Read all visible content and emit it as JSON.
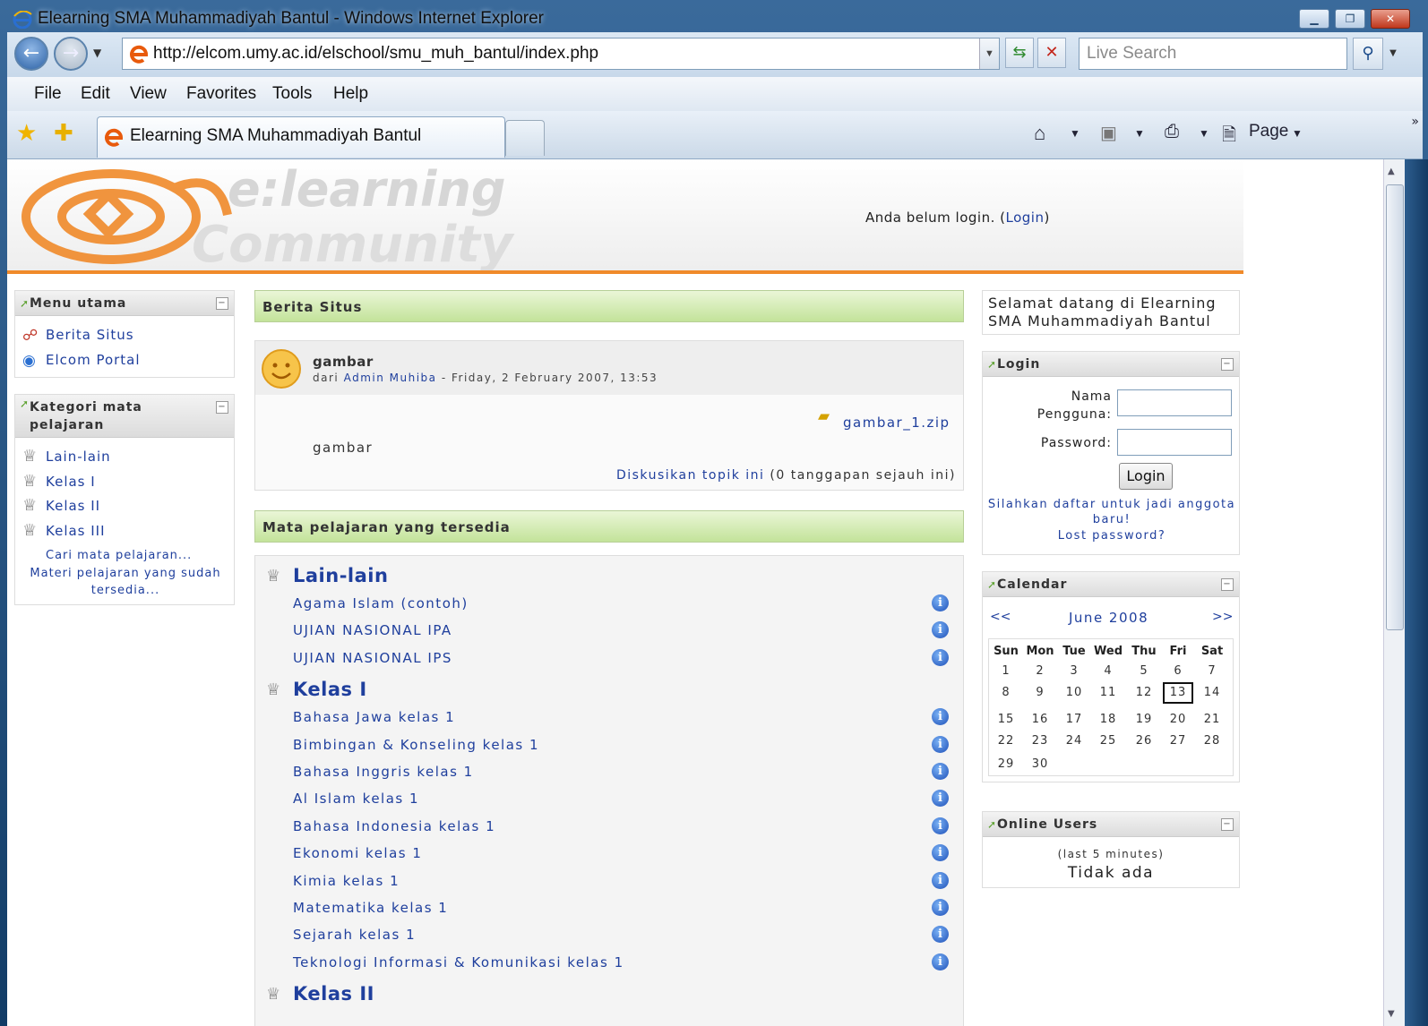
{
  "window": {
    "title": "Elearning SMA Muhammadiyah Bantul - Windows Internet Explorer",
    "url": "http://elcom.umy.ac.id/elschool/smu_muh_bantul/index.php",
    "search_placeholder": "Live Search"
  },
  "menu": [
    "File",
    "Edit",
    "View",
    "Favorites",
    "Tools",
    "Help"
  ],
  "tab": {
    "title": "Elearning SMA Muhammadiyah Bantul"
  },
  "commandbar": {
    "page_label": "Page"
  },
  "header": {
    "login_status": "Anda belum login. (",
    "login_link": "Login",
    "login_close": ")",
    "logo_line1": "e:learning",
    "logo_line2": "Community"
  },
  "menu_utama": {
    "title": "Menu utama",
    "items": [
      "Berita Situs",
      "Elcom Portal"
    ]
  },
  "kategori": {
    "title": "Kategori mata pelajaran",
    "items": [
      "Lain-lain",
      "Kelas I",
      "Kelas II",
      "Kelas III"
    ],
    "search_link": "Cari mata pelajaran...",
    "all_link": "Materi pelajaran yang sudah tersedia..."
  },
  "news": {
    "section_title": "Berita Situs",
    "post_title": "gambar",
    "author_prefix": "dari",
    "author": "Admin Muhiba",
    "date": "- Friday, 2 February 2007, 13:53",
    "attachment": "gambar_1.zip",
    "body": "gambar",
    "discuss": "Diskusikan topik ini",
    "replies": "(0 tanggapan sejauh ini)"
  },
  "courses": {
    "section_title": "Mata pelajaran yang tersedia",
    "categories": [
      {
        "name": "Lain-lain",
        "items": [
          "Agama Islam (contoh)",
          "UJIAN NASIONAL IPA",
          "UJIAN NASIONAL IPS"
        ]
      },
      {
        "name": "Kelas I",
        "items": [
          "Bahasa Jawa kelas 1",
          "Bimbingan & Konseling kelas 1",
          "Bahasa Inggris kelas 1",
          "Al Islam kelas 1",
          "Bahasa Indonesia kelas 1",
          "Ekonomi kelas 1",
          "Kimia kelas 1",
          "Matematika kelas 1",
          "Sejarah kelas 1",
          "Teknologi Informasi & Komunikasi kelas 1"
        ]
      },
      {
        "name": "Kelas II",
        "items": []
      }
    ]
  },
  "welcome": {
    "text": "Selamat datang di Elearning SMA Muhammadiyah Bantul"
  },
  "login": {
    "title": "Login",
    "username_label_1": "Nama",
    "username_label_2": "Pengguna:",
    "password_label": "Password:",
    "button": "Login",
    "signup_link": "Silahkan daftar untuk jadi anggota baru!",
    "lost_password": "Lost password?"
  },
  "calendar": {
    "title": "Calendar",
    "prev": "<<",
    "next": ">>",
    "month": "June 2008",
    "weekdays": [
      "Sun",
      "Mon",
      "Tue",
      "Wed",
      "Thu",
      "Fri",
      "Sat"
    ],
    "weeks": [
      [
        "1",
        "2",
        "3",
        "4",
        "5",
        "6",
        "7"
      ],
      [
        "8",
        "9",
        "10",
        "11",
        "12",
        "13",
        "14"
      ],
      [
        "15",
        "16",
        "17",
        "18",
        "19",
        "20",
        "21"
      ],
      [
        "22",
        "23",
        "24",
        "25",
        "26",
        "27",
        "28"
      ],
      [
        "29",
        "30",
        "",
        "",
        "",
        "",
        ""
      ]
    ],
    "today": "13"
  },
  "online": {
    "title": "Online Users",
    "note": "(last 5 minutes)",
    "status": "Tidak ada"
  },
  "colors": {
    "accent_orange": "#f08a2a",
    "link_blue": "#1f3f9d",
    "section_green": "#c3e39a"
  }
}
